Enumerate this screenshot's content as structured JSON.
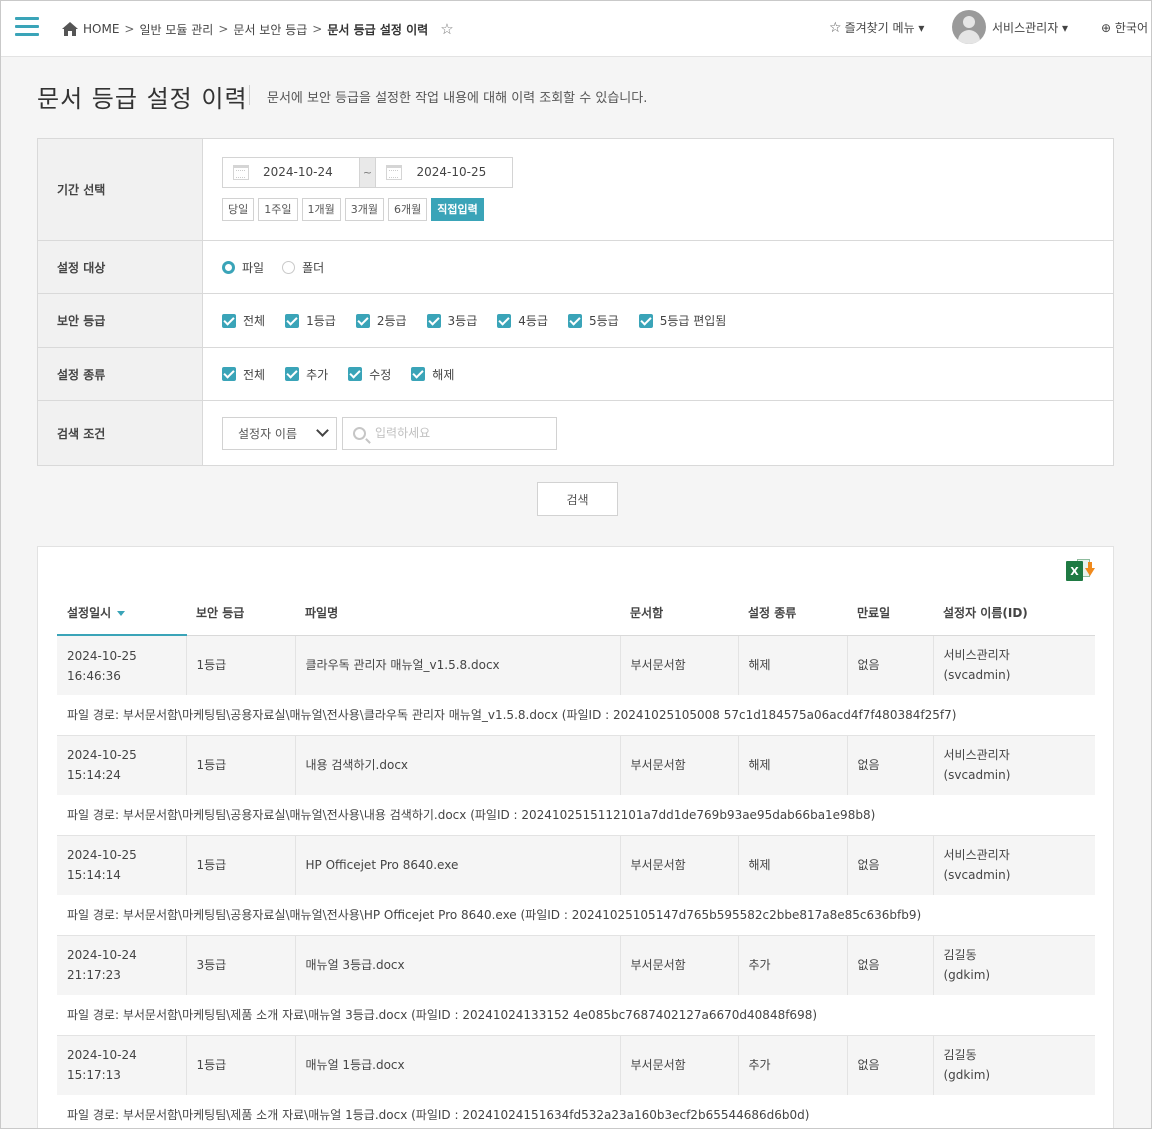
{
  "header": {
    "breadcrumb": [
      "HOME",
      "일반 모듈 관리",
      "문서 보안 등급",
      "문서 등급 설정 이력"
    ],
    "separator": ">",
    "favorites_label": "즐겨찾기 메뉴 ▾",
    "user_name": "서비스관리자 ▾",
    "language": "한국어"
  },
  "page": {
    "title": "문서 등급 설정 이력",
    "description": "문서에 보안 등급을 설정한 작업 내용에 대해 이력 조회할 수 있습니다."
  },
  "filter": {
    "period": {
      "label": "기간 선택",
      "start": "2024-10-24",
      "end": "2024-10-25",
      "tilde": "~",
      "quick": [
        "당일",
        "1주일",
        "1개월",
        "3개월",
        "6개월",
        "직접입력"
      ],
      "quick_active": "직접입력"
    },
    "target": {
      "label": "설정 대상",
      "options": [
        "파일",
        "폴더"
      ],
      "selected": "파일"
    },
    "grade": {
      "label": "보안 등급",
      "options": [
        "전체",
        "1등급",
        "2등급",
        "3등급",
        "4등급",
        "5등급",
        "5등급 편입됨"
      ]
    },
    "kind": {
      "label": "설정 종류",
      "options": [
        "전체",
        "추가",
        "수정",
        "해제"
      ]
    },
    "condition": {
      "label": "검색 조건",
      "select_value": "설정자 이름",
      "placeholder": "입력하세요"
    },
    "search_button": "검색"
  },
  "results": {
    "columns": [
      "설정일시",
      "보안 등급",
      "파일명",
      "문서함",
      "설정 종류",
      "만료일",
      "설정자 이름(ID)"
    ],
    "rows": [
      {
        "date": "2024-10-25",
        "time": "16:46:36",
        "grade": "1등급",
        "file": "클라우독 관리자 매뉴얼_v1.5.8.docx",
        "box": "부서문서함",
        "kind": "해제",
        "expire": "없음",
        "user": "서비스관리자",
        "user_id": "(svcadmin)",
        "path": "파일 경로: 부서문서함\\마케팅팀\\공용자료실\\매뉴얼\\전사용\\클라우독 관리자 매뉴얼_v1.5.8.docx (파일ID : 20241025105008 57c1d184575a06acd4f7f480384f25f7)"
      },
      {
        "date": "2024-10-25",
        "time": "15:14:24",
        "grade": "1등급",
        "file": "내용 검색하기.docx",
        "box": "부서문서함",
        "kind": "해제",
        "expire": "없음",
        "user": "서비스관리자",
        "user_id": "(svcadmin)",
        "path": "파일 경로: 부서문서함\\마케팅팀\\공용자료실\\매뉴얼\\전사용\\내용 검색하기.docx (파일ID : 2024102515112101a7dd1de769b93ae95dab66ba1e98b8)"
      },
      {
        "date": "2024-10-25",
        "time": "15:14:14",
        "grade": "1등급",
        "file": "HP Officejet Pro 8640.exe",
        "box": "부서문서함",
        "kind": "해제",
        "expire": "없음",
        "user": "서비스관리자",
        "user_id": "(svcadmin)",
        "path": "파일 경로: 부서문서함\\마케팅팀\\공용자료실\\매뉴얼\\전사용\\HP Officejet Pro 8640.exe (파일ID : 20241025105147d765b595582c2bbe817a8e85c636bfb9)"
      },
      {
        "date": "2024-10-24",
        "time": "21:17:23",
        "grade": "3등급",
        "file": "매뉴얼 3등급.docx",
        "box": "부서문서함",
        "kind": "추가",
        "expire": "없음",
        "user": "김길동",
        "user_id": "(gdkim)",
        "path": "파일 경로: 부서문서함\\마케팅팀\\제품 소개 자료\\매뉴얼 3등급.docx (파일ID : 20241024133152 4e085bc7687402127a6670d40848f698)"
      },
      {
        "date": "2024-10-24",
        "time": "15:17:13",
        "grade": "1등급",
        "file": "매뉴얼 1등급.docx",
        "box": "부서문서함",
        "kind": "추가",
        "expire": "없음",
        "user": "김길동",
        "user_id": "(gdkim)",
        "path": "파일 경로: 부서문서함\\마케팅팀\\제품 소개 자료\\매뉴얼 1등급.docx (파일ID : 20241024151634fd532a23a160b3ecf2b65544686d6b0d)"
      }
    ]
  },
  "colors": {
    "accent": "#3aa4b8",
    "excel_green": "#1f7a43",
    "excel_arrow": "#f08a1d"
  },
  "icons": [
    "hamburger-menu-icon",
    "home-icon",
    "star-icon",
    "user-avatar-icon",
    "globe-icon",
    "calendar-icon",
    "search-icon",
    "chevron-down-icon",
    "excel-download-icon",
    "sort-desc-icon"
  ]
}
